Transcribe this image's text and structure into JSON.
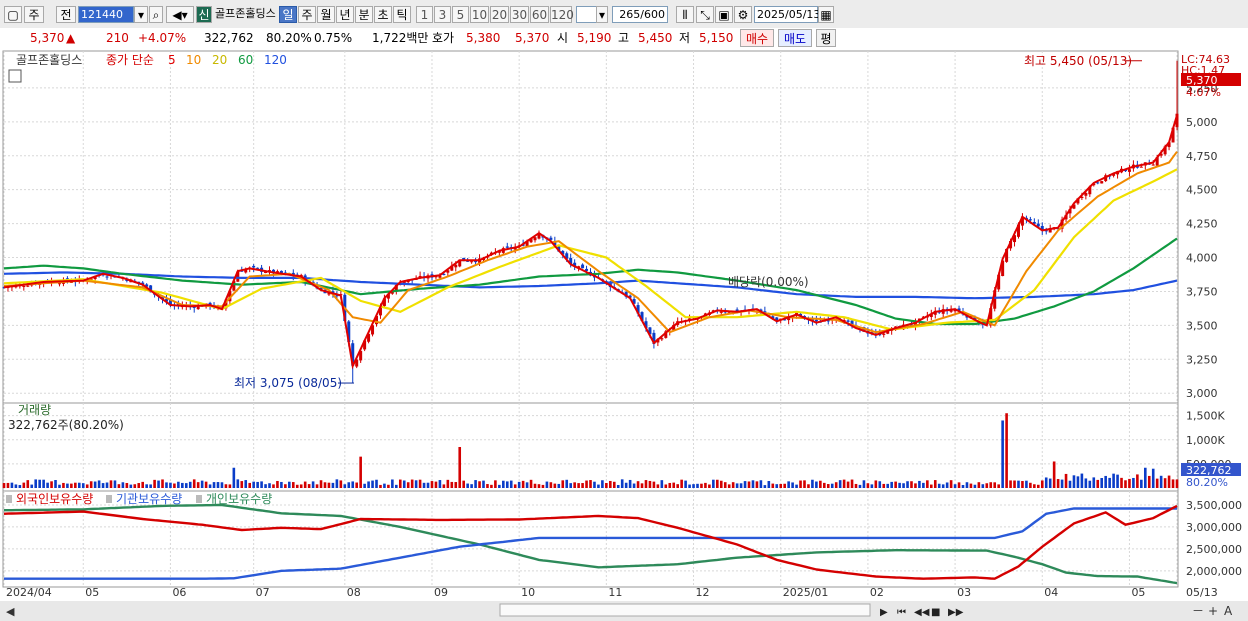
{
  "toolbar": {
    "period_code": "주",
    "prev_label": "전",
    "stock_code": "121440",
    "stock_name": "골프존홀딩스",
    "new_label": "신",
    "period_tabs": [
      "일",
      "주",
      "월",
      "년",
      "분",
      "초",
      "틱"
    ],
    "active_tab": "일",
    "interval_tabs": [
      "1",
      "3",
      "5",
      "10",
      "20",
      "30",
      "60",
      "120"
    ],
    "count": "265",
    "count_max": "/600",
    "date": "2025/05/13"
  },
  "quote": {
    "price": "5,370",
    "change": "210",
    "change_pct": "+4.07%",
    "volume": "322,762",
    "vol_ratio": "80.20%",
    "turnover": "0.75%",
    "amount": "1,722백만",
    "bid_label": "호가",
    "bid": "5,380",
    "ask": "5,370",
    "open_label": "시",
    "open": "5,190",
    "high_label": "고",
    "high": "5,450",
    "low_label": "저",
    "low": "5,150",
    "buy_label": "매수",
    "sell_label": "매도",
    "avg_label": "평"
  },
  "colors": {
    "up": "#d40000",
    "down": "#0a3cc8",
    "ma5": "#e00000",
    "ma10": "#f08a00",
    "ma20": "#f0e000",
    "ma60": "#109a40",
    "ma120": "#2050e0",
    "foreign": "#d40000",
    "institution": "#2a5ad8",
    "individual": "#2e8a5a"
  },
  "chart_data": [
    {
      "type": "candlestick",
      "title": "골프존홀딩스",
      "legend": [
        "종가 단순",
        "5",
        "10",
        "20",
        "60",
        "120"
      ],
      "ylim": [
        2950,
        5500
      ],
      "y_ticks": [
        "3,000",
        "3,250",
        "3,500",
        "3,750",
        "4,000",
        "4,250",
        "4,500",
        "4,750",
        "5,000",
        "5,250"
      ],
      "right_labels": {
        "lc": "LC:74.63",
        "hc": "HC:1.47",
        "price": "5,370",
        "pct": "4.07%"
      },
      "annotations": {
        "high": "최고 5,450 (05/13)",
        "low": "최저 3,075 (08/05)",
        "dividend": "배당락(0.00%)"
      },
      "close_path": [
        [
          0,
          3780
        ],
        [
          10,
          3820
        ],
        [
          20,
          3830
        ],
        [
          25,
          3880
        ],
        [
          30,
          3850
        ],
        [
          35,
          3800
        ],
        [
          42,
          3650
        ],
        [
          47,
          3640
        ],
        [
          52,
          3650
        ],
        [
          55,
          3620
        ],
        [
          59,
          3900
        ],
        [
          62,
          3920
        ],
        [
          68,
          3890
        ],
        [
          75,
          3860
        ],
        [
          80,
          3760
        ],
        [
          85,
          3720
        ],
        [
          88,
          3200
        ],
        [
          92,
          3450
        ],
        [
          96,
          3700
        ],
        [
          100,
          3820
        ],
        [
          105,
          3850
        ],
        [
          110,
          3870
        ],
        [
          115,
          3980
        ],
        [
          120,
          3980
        ],
        [
          125,
          4050
        ],
        [
          130,
          4080
        ],
        [
          135,
          4180
        ],
        [
          138,
          4120
        ],
        [
          143,
          3950
        ],
        [
          150,
          3850
        ],
        [
          158,
          3700
        ],
        [
          164,
          3370
        ],
        [
          170,
          3520
        ],
        [
          175,
          3550
        ],
        [
          180,
          3610
        ],
        [
          185,
          3600
        ],
        [
          190,
          3620
        ],
        [
          195,
          3530
        ],
        [
          200,
          3580
        ],
        [
          205,
          3520
        ],
        [
          210,
          3560
        ],
        [
          215,
          3480
        ],
        [
          220,
          3430
        ],
        [
          225,
          3480
        ],
        [
          230,
          3520
        ],
        [
          235,
          3600
        ],
        [
          240,
          3620
        ],
        [
          245,
          3540
        ],
        [
          248,
          3500
        ],
        [
          252,
          3990
        ],
        [
          257,
          4300
        ],
        [
          262,
          4200
        ],
        [
          266,
          4220
        ],
        [
          270,
          4400
        ],
        [
          275,
          4550
        ],
        [
          280,
          4620
        ],
        [
          285,
          4670
        ],
        [
          290,
          4700
        ],
        [
          294,
          4850
        ],
        [
          296,
          5050
        ]
      ],
      "ma10_path": [
        [
          0,
          3790
        ],
        [
          20,
          3830
        ],
        [
          35,
          3780
        ],
        [
          45,
          3650
        ],
        [
          55,
          3640
        ],
        [
          62,
          3860
        ],
        [
          72,
          3880
        ],
        [
          82,
          3760
        ],
        [
          88,
          3560
        ],
        [
          95,
          3520
        ],
        [
          102,
          3760
        ],
        [
          112,
          3860
        ],
        [
          122,
          3980
        ],
        [
          132,
          4080
        ],
        [
          140,
          4120
        ],
        [
          150,
          3900
        ],
        [
          160,
          3700
        ],
        [
          168,
          3450
        ],
        [
          178,
          3560
        ],
        [
          188,
          3610
        ],
        [
          198,
          3560
        ],
        [
          210,
          3540
        ],
        [
          220,
          3450
        ],
        [
          232,
          3510
        ],
        [
          242,
          3600
        ],
        [
          250,
          3500
        ],
        [
          258,
          3900
        ],
        [
          266,
          4200
        ],
        [
          276,
          4450
        ],
        [
          286,
          4620
        ],
        [
          294,
          4700
        ],
        [
          296,
          4780
        ]
      ],
      "ma20_path": [
        [
          0,
          3810
        ],
        [
          20,
          3840
        ],
        [
          40,
          3740
        ],
        [
          55,
          3620
        ],
        [
          65,
          3770
        ],
        [
          80,
          3850
        ],
        [
          90,
          3680
        ],
        [
          100,
          3600
        ],
        [
          112,
          3780
        ],
        [
          125,
          3930
        ],
        [
          140,
          4090
        ],
        [
          152,
          4000
        ],
        [
          162,
          3790
        ],
        [
          172,
          3560
        ],
        [
          185,
          3560
        ],
        [
          200,
          3600
        ],
        [
          212,
          3560
        ],
        [
          224,
          3470
        ],
        [
          238,
          3520
        ],
        [
          250,
          3540
        ],
        [
          260,
          3760
        ],
        [
          270,
          4150
        ],
        [
          280,
          4420
        ],
        [
          290,
          4560
        ],
        [
          296,
          4650
        ]
      ],
      "ma60_path": [
        [
          0,
          3920
        ],
        [
          10,
          3940
        ],
        [
          20,
          3920
        ],
        [
          30,
          3880
        ],
        [
          45,
          3830
        ],
        [
          60,
          3800
        ],
        [
          75,
          3820
        ],
        [
          90,
          3730
        ],
        [
          105,
          3770
        ],
        [
          120,
          3800
        ],
        [
          135,
          3860
        ],
        [
          150,
          3880
        ],
        [
          160,
          3910
        ],
        [
          170,
          3890
        ],
        [
          185,
          3830
        ],
        [
          200,
          3760
        ],
        [
          215,
          3650
        ],
        [
          225,
          3550
        ],
        [
          235,
          3510
        ],
        [
          245,
          3510
        ],
        [
          255,
          3550
        ],
        [
          265,
          3640
        ],
        [
          275,
          3750
        ],
        [
          285,
          3920
        ],
        [
          296,
          4140
        ]
      ],
      "ma120_path": [
        [
          0,
          3880
        ],
        [
          15,
          3890
        ],
        [
          30,
          3880
        ],
        [
          45,
          3860
        ],
        [
          60,
          3850
        ],
        [
          75,
          3850
        ],
        [
          90,
          3820
        ],
        [
          105,
          3800
        ],
        [
          120,
          3780
        ],
        [
          135,
          3790
        ],
        [
          150,
          3810
        ],
        [
          160,
          3830
        ],
        [
          170,
          3810
        ],
        [
          185,
          3780
        ],
        [
          200,
          3730
        ],
        [
          215,
          3710
        ],
        [
          230,
          3710
        ],
        [
          245,
          3700
        ],
        [
          260,
          3710
        ],
        [
          275,
          3730
        ],
        [
          285,
          3760
        ],
        [
          296,
          3830
        ]
      ]
    },
    {
      "type": "bar",
      "title": "거래량",
      "subtitle": "322,762주(80.20%)",
      "ylim": [
        0,
        1700000
      ],
      "y_ticks": [
        "500,000",
        "1,000,000",
        "1,500,000"
      ],
      "y_tick_labels": [
        "500,000",
        "1,000K",
        "1,500K"
      ],
      "right_labels": {
        "vol": "322,762",
        "pct": "80.20%"
      },
      "spikes": [
        [
          58,
          420000
        ],
        [
          90,
          650000
        ],
        [
          115,
          850000
        ],
        [
          252,
          1400000
        ],
        [
          253,
          1550000
        ],
        [
          265,
          550000
        ],
        [
          288,
          420000
        ],
        [
          290,
          400000
        ]
      ]
    },
    {
      "type": "line",
      "legend": [
        "외국인보유수량",
        "기관보유수량",
        "개인보유수량"
      ],
      "ylim": [
        1700000,
        3750000
      ],
      "y_ticks": [
        "2,000,000",
        "2,500,000",
        "3,000,000",
        "3,500,000"
      ],
      "x_ticks": [
        "2024/04",
        "05",
        "06",
        "07",
        "08",
        "09",
        "10",
        "11",
        "12",
        "2025/01",
        "02",
        "03",
        "04",
        "05",
        "05/13"
      ],
      "foreign_path": [
        [
          0,
          3300000
        ],
        [
          20,
          3350000
        ],
        [
          35,
          3180000
        ],
        [
          50,
          3050000
        ],
        [
          60,
          2930000
        ],
        [
          70,
          2980000
        ],
        [
          80,
          2950000
        ],
        [
          90,
          3180000
        ],
        [
          110,
          3160000
        ],
        [
          130,
          3170000
        ],
        [
          150,
          3250000
        ],
        [
          160,
          3200000
        ],
        [
          170,
          2980000
        ],
        [
          185,
          2600000
        ],
        [
          195,
          2250000
        ],
        [
          205,
          2030000
        ],
        [
          220,
          1870000
        ],
        [
          232,
          1820000
        ],
        [
          245,
          1850000
        ],
        [
          250,
          1820000
        ],
        [
          256,
          2100000
        ],
        [
          262,
          2550000
        ],
        [
          270,
          3080000
        ],
        [
          278,
          3330000
        ],
        [
          283,
          3050000
        ],
        [
          290,
          3200000
        ],
        [
          296,
          3480000
        ]
      ],
      "institution_path": [
        [
          0,
          1820000
        ],
        [
          20,
          1820000
        ],
        [
          30,
          1820000
        ],
        [
          50,
          1820000
        ],
        [
          58,
          1830000
        ],
        [
          70,
          2000000
        ],
        [
          85,
          2050000
        ],
        [
          100,
          2300000
        ],
        [
          115,
          2550000
        ],
        [
          135,
          2750000
        ],
        [
          180,
          2750000
        ],
        [
          250,
          2750000
        ],
        [
          257,
          2900000
        ],
        [
          263,
          3300000
        ],
        [
          270,
          3420000
        ],
        [
          296,
          3420000
        ]
      ],
      "individual_path": [
        [
          0,
          3380000
        ],
        [
          20,
          3400000
        ],
        [
          40,
          3480000
        ],
        [
          55,
          3500000
        ],
        [
          70,
          3310000
        ],
        [
          85,
          3250000
        ],
        [
          100,
          3000000
        ],
        [
          120,
          2600000
        ],
        [
          135,
          2250000
        ],
        [
          150,
          2080000
        ],
        [
          170,
          2150000
        ],
        [
          185,
          2300000
        ],
        [
          205,
          2420000
        ],
        [
          225,
          2470000
        ],
        [
          248,
          2460000
        ],
        [
          255,
          2320000
        ],
        [
          262,
          2150000
        ],
        [
          268,
          1960000
        ],
        [
          276,
          1880000
        ],
        [
          286,
          1870000
        ],
        [
          296,
          1720000
        ]
      ]
    }
  ],
  "bottom": {
    "scroll_buttons": [
      "▶",
      "⏮",
      "◀◀",
      "■",
      "▶▶"
    ],
    "zoom": [
      "－",
      "+",
      "A"
    ]
  }
}
